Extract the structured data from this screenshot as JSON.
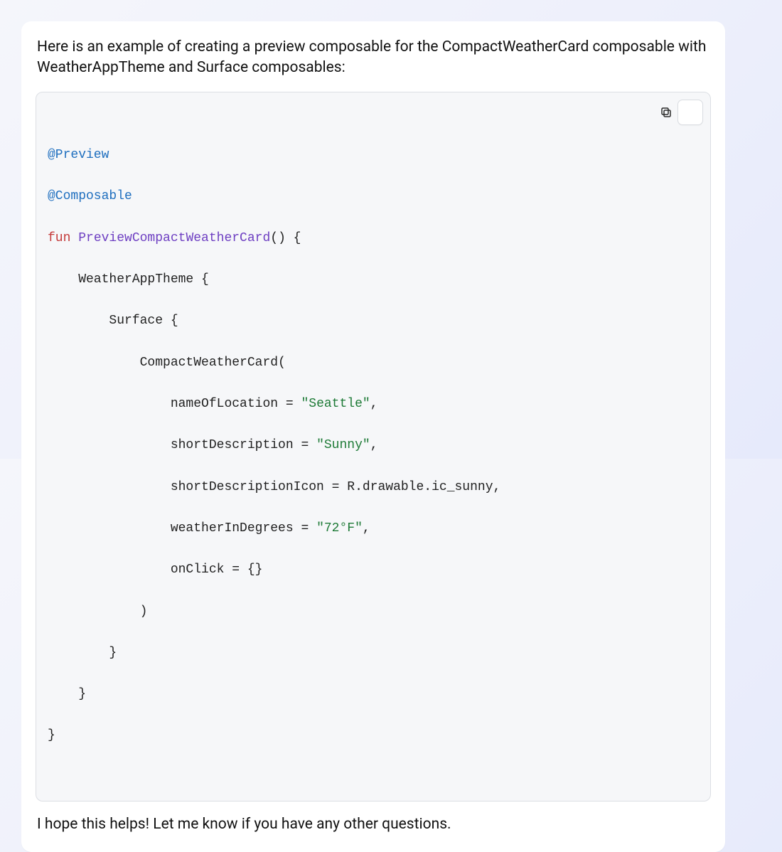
{
  "intro": "Here is an example of creating a preview composable for the CompactWeatherCard composable with WeatherAppTheme and Surface composables:",
  "outro": "I hope this helps! Let me know if you have any other questions.",
  "copy_button": {
    "icon": "copy-icon",
    "aria": "Copy code"
  },
  "code": {
    "annotations": {
      "preview": "@Preview",
      "composable": "@Composable"
    },
    "keyword_fun": "fun",
    "function_name": "PreviewCompactWeatherCard",
    "open_paren_brace": "() {",
    "l_theme_open": "    WeatherAppTheme {",
    "l_surface_open": "        Surface {",
    "l_call_open": "            CompactWeatherCard(",
    "arg_name_loc": "                nameOfLocation = ",
    "val_loc": "\"Seattle\"",
    "comma": ",",
    "arg_name_desc": "                shortDescription = ",
    "val_desc": "\"Sunny\"",
    "arg_icon_full": "                shortDescriptionIcon = R.drawable.ic_sunny,",
    "arg_name_deg": "                weatherInDegrees = ",
    "val_deg": "\"72°F\"",
    "arg_onclick": "                onClick = {}",
    "l_call_close": "            )",
    "l_surface_close": "        }",
    "l_theme_close": "    }",
    "l_fun_close": "}"
  }
}
